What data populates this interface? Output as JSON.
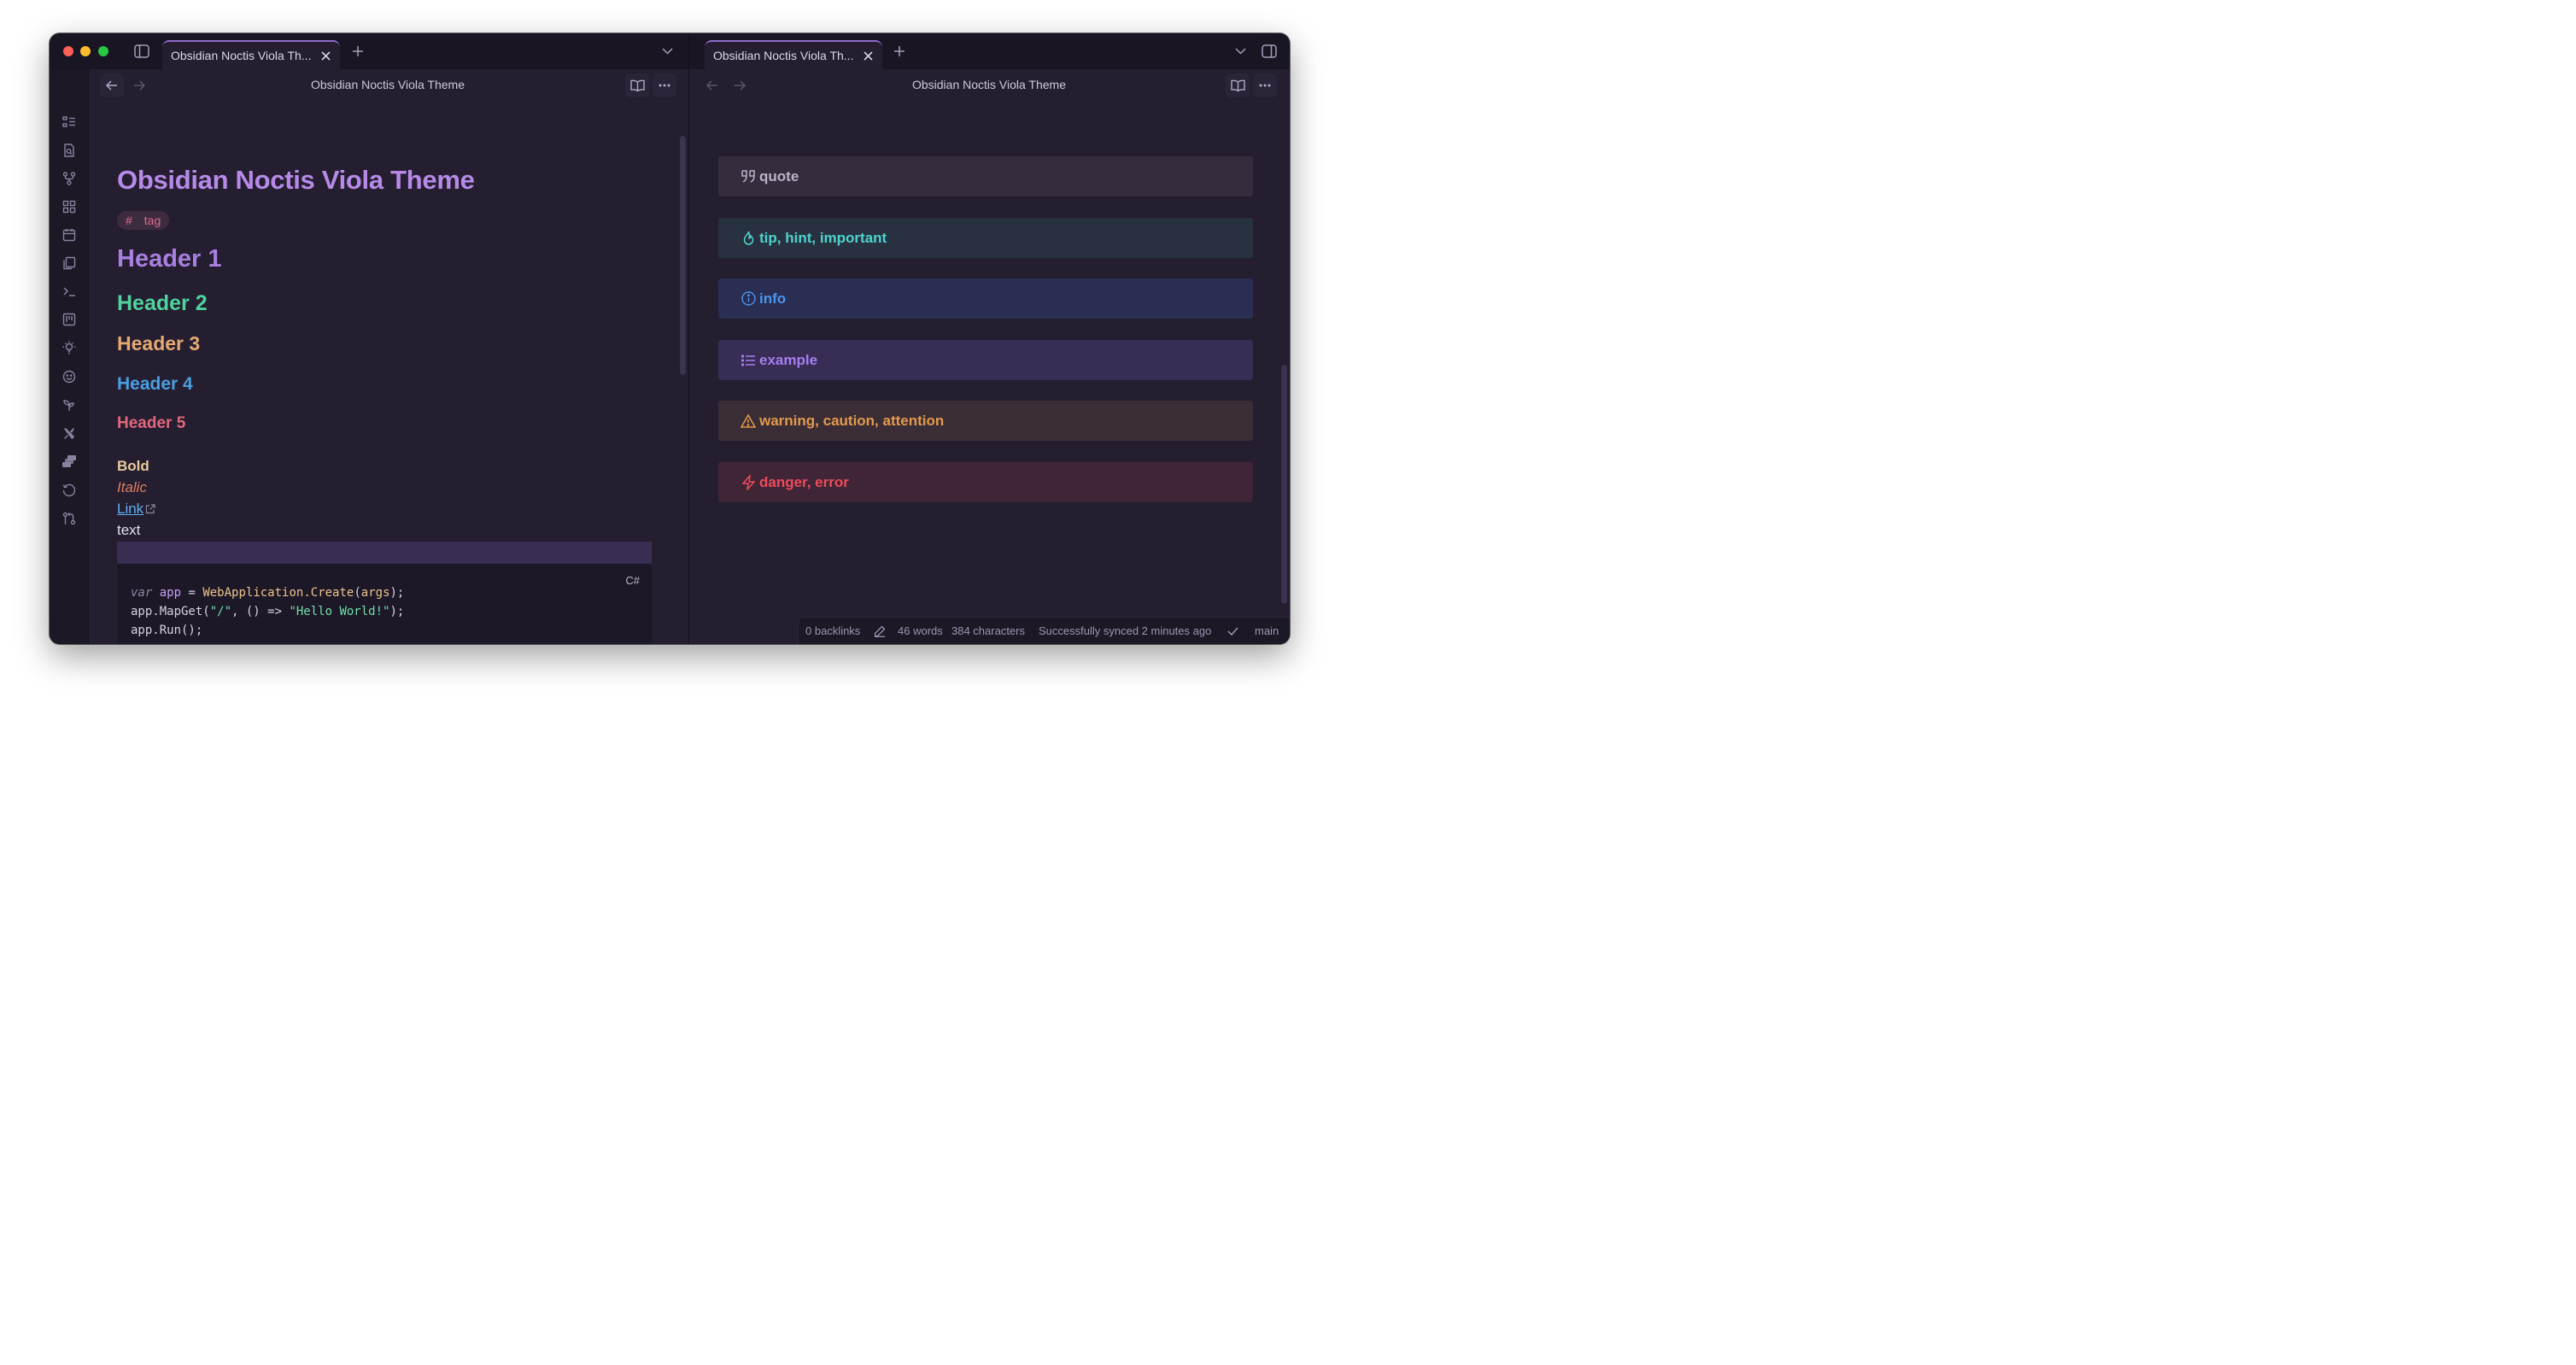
{
  "window": {
    "left_tab_title": "Obsidian Noctis Viola Th...",
    "right_tab_title": "Obsidian Noctis Viola Th..."
  },
  "ribbon": {
    "icons": [
      "list-icon",
      "file-search-icon",
      "git-fork-icon",
      "grid-icon",
      "calendar-icon",
      "copy-icon",
      "terminal-icon",
      "kanban-icon",
      "lightbulb-icon",
      "smiley-icon",
      "sprout-icon",
      "tools-icon",
      "layers-icon",
      "history-icon",
      "git-compare-icon"
    ]
  },
  "left_pane": {
    "nav_title": "Obsidian Noctis Viola Theme",
    "doc_title": "Obsidian Noctis Viola Theme",
    "tag_hash": "#",
    "tag_label": "tag",
    "header1": "Header 1",
    "header2": "Header 2",
    "header3": "Header 3",
    "header4": "Header 4",
    "header5": "Header 5",
    "bold": "Bold",
    "italic": "Italic",
    "link": "Link",
    "text": "text",
    "code_lang": "C#",
    "code_lines": [
      "var app = WebApplication.Create(args);",
      "app.MapGet(\"/\", () => \"Hello World!\");",
      "app.Run();"
    ],
    "code_tokens": {
      "l1_kw": "var",
      "l1_var": "app",
      "l1_eq": " = ",
      "l1_fn": "WebApplication.Create",
      "l1_open": "(",
      "l1_arg": "args",
      "l1_close": ");",
      "l2_a": "app.MapGet(",
      "l2_s1": "\"/\"",
      "l2_b": ", () => ",
      "l2_s2": "\"Hello World!\"",
      "l2_c": ");",
      "l3": "app.Run();"
    }
  },
  "right_pane": {
    "nav_title": "Obsidian Noctis Viola Theme",
    "callouts": [
      {
        "label": "quote",
        "color": "#bcb3c9",
        "bg": "#352d3e",
        "icon": "quote-icon"
      },
      {
        "label": "tip, hint, important",
        "color": "#4ed3cf",
        "bg": "#283140",
        "icon": "flame-icon"
      },
      {
        "label": "info",
        "color": "#4a95ee",
        "bg": "#2a2e52",
        "icon": "info-icon"
      },
      {
        "label": "example",
        "color": "#a67ef0",
        "bg": "#382d55",
        "icon": "list-icon"
      },
      {
        "label": "warning, caution, attention",
        "color": "#e49a4c",
        "bg": "#3a2d36",
        "icon": "alert-triangle-icon"
      },
      {
        "label": "danger, error",
        "color": "#ee4a5c",
        "bg": "#3f2535",
        "icon": "zap-icon"
      }
    ]
  },
  "statusbar": {
    "backlinks": "0 backlinks",
    "words": "46 words",
    "characters": "384 characters",
    "sync": "Successfully synced 2 minutes ago",
    "branch": "main"
  },
  "colors": {
    "accent": "#8e6cc9",
    "background": "#241e30",
    "sidebar": "#1d1826"
  }
}
